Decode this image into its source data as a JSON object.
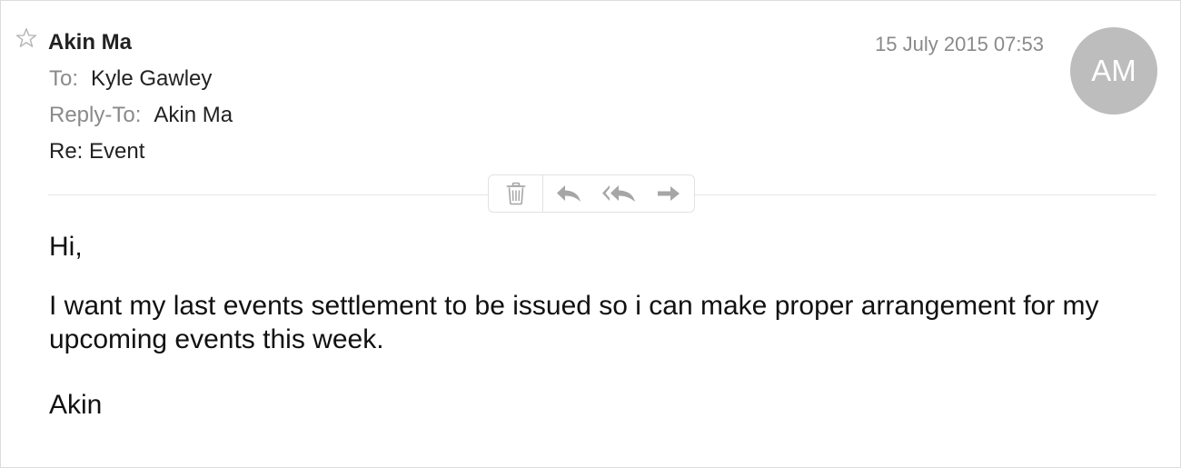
{
  "message": {
    "sender": "Akin Ma",
    "date": "15 July 2015 07:53",
    "avatar_initials": "AM",
    "to_label": "To:",
    "to_value": "Kyle Gawley",
    "reply_to_label": "Reply-To:",
    "reply_to_value": "Akin Ma",
    "subject": "Re: Event",
    "body": {
      "greeting": "Hi,",
      "paragraph": "I want my last events settlement to be issued so i can make proper arrangement for my upcoming events this week.",
      "signature": "Akin"
    }
  },
  "toolbar": {
    "icons": [
      "trash-icon",
      "reply-icon",
      "reply-all-icon",
      "forward-icon"
    ]
  },
  "colors": {
    "avatar_bg": "#bdbdbd",
    "muted_text": "#8a8a8a",
    "icon_gray": "#a6a6a6"
  }
}
